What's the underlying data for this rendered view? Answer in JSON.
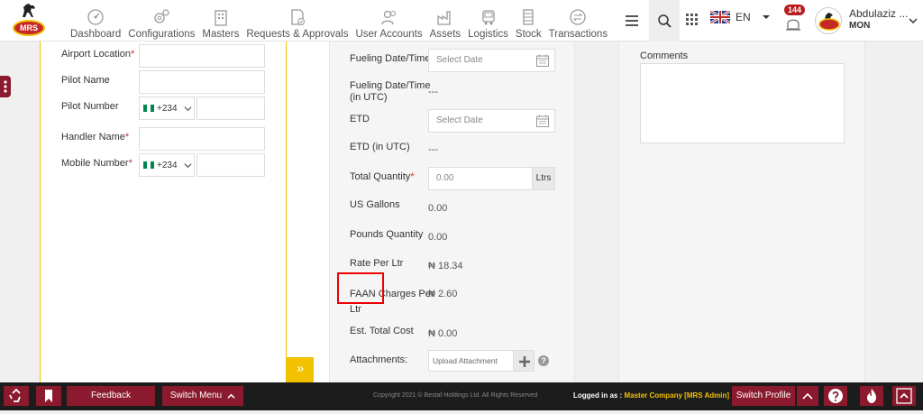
{
  "logo": {
    "text": "MRS"
  },
  "nav": [
    {
      "label": "Dashboard",
      "icon": "dashboard-icon"
    },
    {
      "label": "Configurations",
      "icon": "gears-icon"
    },
    {
      "label": "Masters",
      "icon": "building-icon"
    },
    {
      "label": "Requests & Approvals",
      "icon": "document-check-icon"
    },
    {
      "label": "User Accounts",
      "icon": "users-icon"
    },
    {
      "label": "Assets",
      "icon": "factory-icon"
    },
    {
      "label": "Logistics",
      "icon": "truck-icon"
    },
    {
      "label": "Stock",
      "icon": "stack-icon"
    },
    {
      "label": "Transactions",
      "icon": "exchange-icon"
    }
  ],
  "header": {
    "language": "EN",
    "notifications": "144",
    "user_name": "Abdulaziz ...",
    "user_role": "MON"
  },
  "form_left": {
    "airport_location_label": "Airport Location",
    "pilot_name_label": "Pilot Name",
    "pilot_number_label": "Pilot Number",
    "pilot_number_code": "+234",
    "handler_name_label": "Handler Name",
    "mobile_number_label": "Mobile Number",
    "mobile_number_code": "+234"
  },
  "form_mid": {
    "fueling_datetime_label": "Fueling Date/Time",
    "fueling_datetime_placeholder": "Select Date",
    "fueling_utc_label_1": "Fueling Date/Time",
    "fueling_utc_label_2": "(in UTC)",
    "fueling_utc_value": "---",
    "etd_label": "ETD",
    "etd_placeholder": "Select Date",
    "etd_utc_label": "ETD (in UTC)",
    "etd_utc_value": "---",
    "total_quantity_label": "Total Quantity",
    "total_quantity_placeholder": "0.00",
    "total_quantity_unit": "Ltrs",
    "us_gallons_label": "US Gallons",
    "us_gallons_value": "0.00",
    "pounds_label": "Pounds Quantity",
    "pounds_value": "0.00",
    "rate_label": "Rate Per Ltr",
    "rate_value": "₦ 18.34",
    "faan_label_1": "FAAN Charges Per",
    "faan_label_2": "Ltr",
    "faan_value": "₦ 2.60",
    "est_total_label": "Est. Total Cost",
    "est_total_value": "₦ 0.00",
    "attachments_label": "Attachments:",
    "attachments_placeholder": "Upload Attachment",
    "help_glyph": "?"
  },
  "form_right": {
    "comments_label": "Comments"
  },
  "required_mark": "*",
  "expand_glyph": "»",
  "bottom": {
    "feedback_label": "Feedback",
    "switch_menu_label": "Switch Menu",
    "copyright": "Copyright 2021 © Bestaf Holdings Ltd. All Rights Reserved",
    "logged_in_label": "Logged in as :",
    "logged_in_value": "Master Company [MRS Admin]",
    "switch_profile_label": "Switch Profile"
  }
}
